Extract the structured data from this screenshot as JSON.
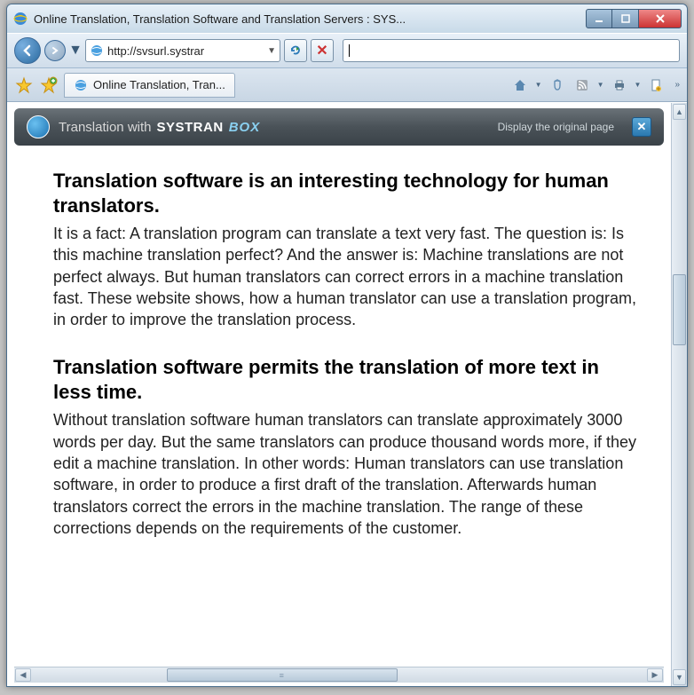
{
  "window": {
    "title": "Online Translation, Translation Software and Translation Servers : SYS..."
  },
  "nav": {
    "url": "http://svsurl.systrar"
  },
  "tab": {
    "label": "Online Translation, Tran..."
  },
  "systran": {
    "prefix": "Translation with",
    "brand": "SYSTRAN",
    "box": "BOX",
    "link": "Display the original page"
  },
  "article": {
    "h1": "Translation software is an interesting technology for human translators.",
    "p1": "It is a fact: A translation program can translate a text very fast. The question is: Is this machine translation perfect? And the answer is: Machine translations are not perfect always. But human translators can correct errors in a machine translation fast. These website shows, how a human translator can use a translation program, in order to improve the translation process.",
    "h2": "Translation software permits the translation of more text in less time.",
    "p2": "Without translation software human translators can translate approximately 3000 words per day. But the same translators can produce thousand words more, if they edit a machine translation. In other words: Human translators can use translation software, in order to produce a first draft of the translation. Afterwards human translators correct the errors in the machine translation. The range of these corrections depends on the requirements of the customer."
  }
}
